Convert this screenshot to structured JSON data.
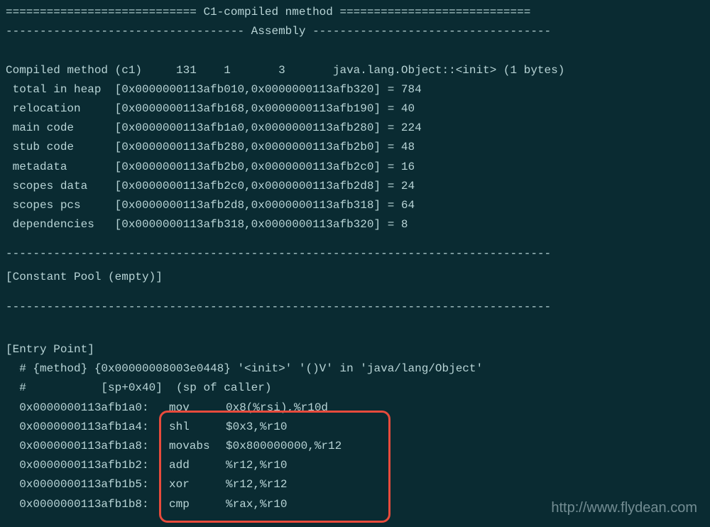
{
  "header": {
    "line1": "============================ C1-compiled nmethod ============================",
    "line2": "----------------------------------- Assembly -----------------------------------"
  },
  "compiled": {
    "prefix": "Compiled method (c1)     131    1       3       java.lang.Object::<init> (1 bytes)"
  },
  "memregions": [
    {
      "label": " total in heap  [0x0000000113afb010,0x0000000113afb320] = 784"
    },
    {
      "label": " relocation     [0x0000000113afb168,0x0000000113afb190] = 40"
    },
    {
      "label": " main code      [0x0000000113afb1a0,0x0000000113afb280] = 224"
    },
    {
      "label": " stub code      [0x0000000113afb280,0x0000000113afb2b0] = 48"
    },
    {
      "label": " metadata       [0x0000000113afb2b0,0x0000000113afb2c0] = 16"
    },
    {
      "label": " scopes data    [0x0000000113afb2c0,0x0000000113afb2d8] = 24"
    },
    {
      "label": " scopes pcs     [0x0000000113afb2d8,0x0000000113afb318] = 64"
    },
    {
      "label": " dependencies   [0x0000000113afb318,0x0000000113afb320] = 8"
    }
  ],
  "divider": "--------------------------------------------------------------------------------",
  "constpool": "[Constant Pool (empty)]",
  "entrypoint_title": "[Entry Point]",
  "entry_meta": [
    "  # {method} {0x00000008003e0448} '<init>' '()V' in 'java/lang/Object'",
    "  #           [sp+0x40]  (sp of caller)"
  ],
  "asm": [
    {
      "addr": "  0x0000000113afb1a0:",
      "mnem": "mov",
      "ops": "0x8(%rsi),%r10d"
    },
    {
      "addr": "  0x0000000113afb1a4:",
      "mnem": "shl",
      "ops": "$0x3,%r10"
    },
    {
      "addr": "  0x0000000113afb1a8:",
      "mnem": "movabs",
      "ops": "$0x800000000,%r12"
    },
    {
      "addr": "  0x0000000113afb1b2:",
      "mnem": "add",
      "ops": "%r12,%r10"
    },
    {
      "addr": "  0x0000000113afb1b5:",
      "mnem": "xor",
      "ops": "%r12,%r12"
    },
    {
      "addr": "  0x0000000113afb1b8:",
      "mnem": "cmp",
      "ops": "%rax,%r10"
    }
  ],
  "watermark": "http://www.flydean.com"
}
